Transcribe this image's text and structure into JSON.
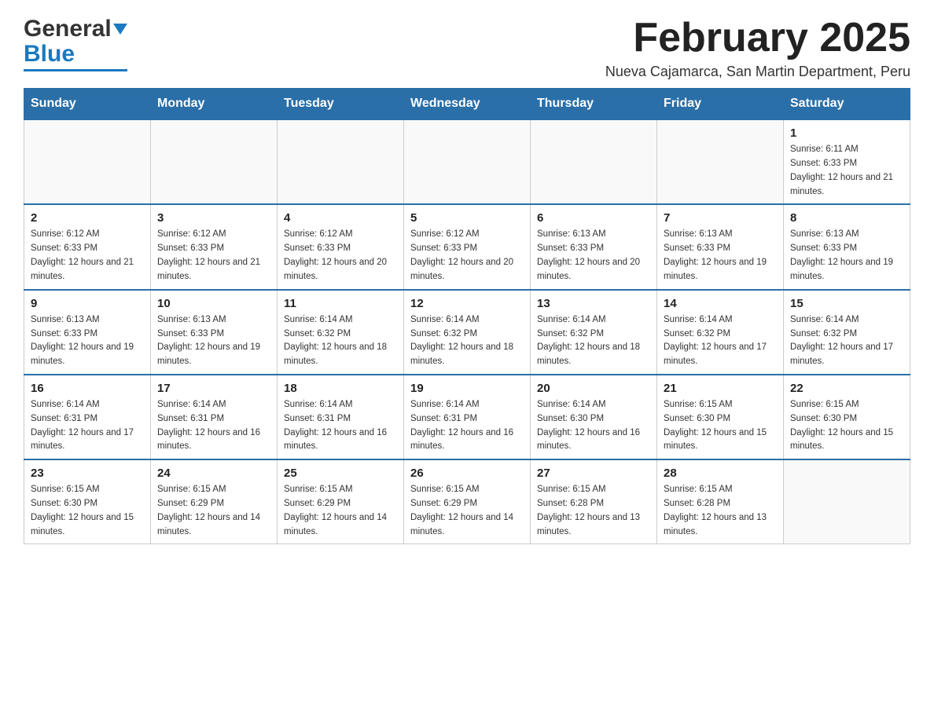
{
  "logo": {
    "word1": "General",
    "word2": "Blue"
  },
  "header": {
    "title": "February 2025",
    "location": "Nueva Cajamarca, San Martin Department, Peru"
  },
  "weekdays": [
    "Sunday",
    "Monday",
    "Tuesday",
    "Wednesday",
    "Thursday",
    "Friday",
    "Saturday"
  ],
  "weeks": [
    [
      {
        "day": "",
        "info": ""
      },
      {
        "day": "",
        "info": ""
      },
      {
        "day": "",
        "info": ""
      },
      {
        "day": "",
        "info": ""
      },
      {
        "day": "",
        "info": ""
      },
      {
        "day": "",
        "info": ""
      },
      {
        "day": "1",
        "info": "Sunrise: 6:11 AM\nSunset: 6:33 PM\nDaylight: 12 hours and 21 minutes."
      }
    ],
    [
      {
        "day": "2",
        "info": "Sunrise: 6:12 AM\nSunset: 6:33 PM\nDaylight: 12 hours and 21 minutes."
      },
      {
        "day": "3",
        "info": "Sunrise: 6:12 AM\nSunset: 6:33 PM\nDaylight: 12 hours and 21 minutes."
      },
      {
        "day": "4",
        "info": "Sunrise: 6:12 AM\nSunset: 6:33 PM\nDaylight: 12 hours and 20 minutes."
      },
      {
        "day": "5",
        "info": "Sunrise: 6:12 AM\nSunset: 6:33 PM\nDaylight: 12 hours and 20 minutes."
      },
      {
        "day": "6",
        "info": "Sunrise: 6:13 AM\nSunset: 6:33 PM\nDaylight: 12 hours and 20 minutes."
      },
      {
        "day": "7",
        "info": "Sunrise: 6:13 AM\nSunset: 6:33 PM\nDaylight: 12 hours and 19 minutes."
      },
      {
        "day": "8",
        "info": "Sunrise: 6:13 AM\nSunset: 6:33 PM\nDaylight: 12 hours and 19 minutes."
      }
    ],
    [
      {
        "day": "9",
        "info": "Sunrise: 6:13 AM\nSunset: 6:33 PM\nDaylight: 12 hours and 19 minutes."
      },
      {
        "day": "10",
        "info": "Sunrise: 6:13 AM\nSunset: 6:33 PM\nDaylight: 12 hours and 19 minutes."
      },
      {
        "day": "11",
        "info": "Sunrise: 6:14 AM\nSunset: 6:32 PM\nDaylight: 12 hours and 18 minutes."
      },
      {
        "day": "12",
        "info": "Sunrise: 6:14 AM\nSunset: 6:32 PM\nDaylight: 12 hours and 18 minutes."
      },
      {
        "day": "13",
        "info": "Sunrise: 6:14 AM\nSunset: 6:32 PM\nDaylight: 12 hours and 18 minutes."
      },
      {
        "day": "14",
        "info": "Sunrise: 6:14 AM\nSunset: 6:32 PM\nDaylight: 12 hours and 17 minutes."
      },
      {
        "day": "15",
        "info": "Sunrise: 6:14 AM\nSunset: 6:32 PM\nDaylight: 12 hours and 17 minutes."
      }
    ],
    [
      {
        "day": "16",
        "info": "Sunrise: 6:14 AM\nSunset: 6:31 PM\nDaylight: 12 hours and 17 minutes."
      },
      {
        "day": "17",
        "info": "Sunrise: 6:14 AM\nSunset: 6:31 PM\nDaylight: 12 hours and 16 minutes."
      },
      {
        "day": "18",
        "info": "Sunrise: 6:14 AM\nSunset: 6:31 PM\nDaylight: 12 hours and 16 minutes."
      },
      {
        "day": "19",
        "info": "Sunrise: 6:14 AM\nSunset: 6:31 PM\nDaylight: 12 hours and 16 minutes."
      },
      {
        "day": "20",
        "info": "Sunrise: 6:14 AM\nSunset: 6:30 PM\nDaylight: 12 hours and 16 minutes."
      },
      {
        "day": "21",
        "info": "Sunrise: 6:15 AM\nSunset: 6:30 PM\nDaylight: 12 hours and 15 minutes."
      },
      {
        "day": "22",
        "info": "Sunrise: 6:15 AM\nSunset: 6:30 PM\nDaylight: 12 hours and 15 minutes."
      }
    ],
    [
      {
        "day": "23",
        "info": "Sunrise: 6:15 AM\nSunset: 6:30 PM\nDaylight: 12 hours and 15 minutes."
      },
      {
        "day": "24",
        "info": "Sunrise: 6:15 AM\nSunset: 6:29 PM\nDaylight: 12 hours and 14 minutes."
      },
      {
        "day": "25",
        "info": "Sunrise: 6:15 AM\nSunset: 6:29 PM\nDaylight: 12 hours and 14 minutes."
      },
      {
        "day": "26",
        "info": "Sunrise: 6:15 AM\nSunset: 6:29 PM\nDaylight: 12 hours and 14 minutes."
      },
      {
        "day": "27",
        "info": "Sunrise: 6:15 AM\nSunset: 6:28 PM\nDaylight: 12 hours and 13 minutes."
      },
      {
        "day": "28",
        "info": "Sunrise: 6:15 AM\nSunset: 6:28 PM\nDaylight: 12 hours and 13 minutes."
      },
      {
        "day": "",
        "info": ""
      }
    ]
  ]
}
